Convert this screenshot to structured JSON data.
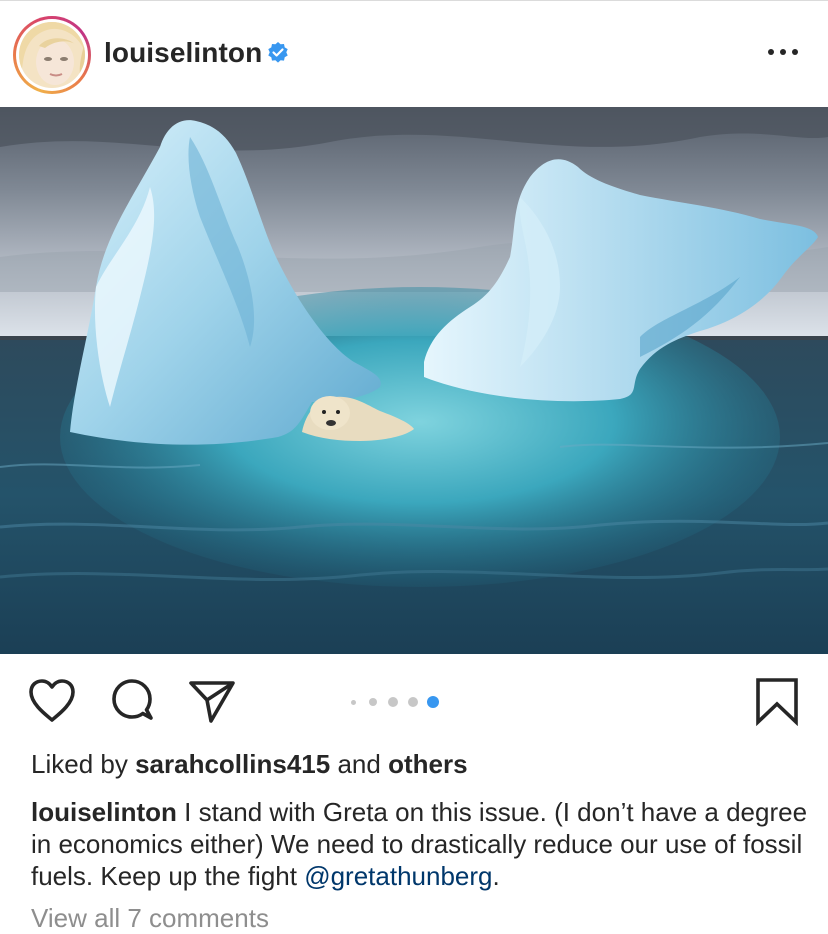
{
  "post": {
    "username": "louiselinton",
    "verified": true,
    "more_icon": "more-options-icon"
  },
  "media": {
    "description_icon": "photo",
    "carousel_total": 5,
    "carousel_active_index": 4
  },
  "actions": {
    "like_icon": "heart-icon",
    "comment_icon": "comment-icon",
    "share_icon": "paper-plane-icon",
    "save_icon": "bookmark-icon"
  },
  "likes": {
    "prefix": "Liked by",
    "user": "sarahcollins415",
    "conjunction": "and",
    "others": "others"
  },
  "caption": {
    "username": "louiselinton",
    "text": "I stand with Greta on this issue. (I don’t have a degree in economics either) We need to drastically reduce our use of fossil fuels. Keep up the fight",
    "mention": "@gretathunberg",
    "end": "."
  },
  "comments": {
    "view_all_label": "View all 7 comments"
  },
  "colors": {
    "text": "#262626",
    "muted": "#8e8e8e",
    "mention": "#00376b",
    "active_dot": "#3897f0",
    "verified": "#3897f0"
  }
}
